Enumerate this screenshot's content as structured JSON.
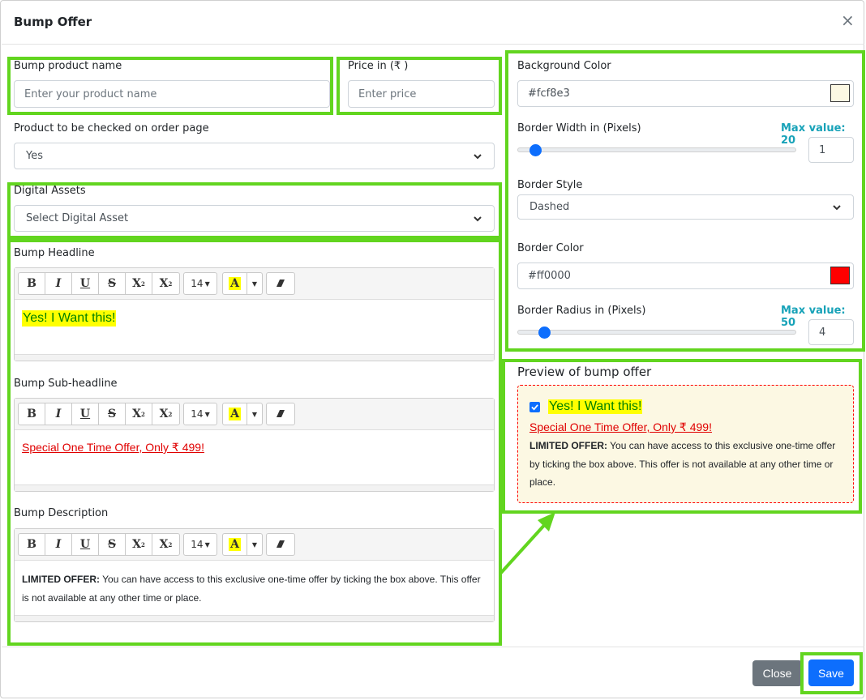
{
  "header": {
    "title": "Bump Offer",
    "close_glyph": "×"
  },
  "form": {
    "product_name": {
      "label": "Bump product name",
      "placeholder": "Enter your product name"
    },
    "price": {
      "label": "Price in (₹ )",
      "placeholder": "Enter price"
    },
    "checked": {
      "label": "Product to be checked on order page",
      "value": "Yes"
    },
    "assets": {
      "label": "Digital Assets",
      "value": "Select Digital Asset"
    }
  },
  "editors": {
    "headline": {
      "label": "Bump Headline",
      "content": "Yes! I Want this!"
    },
    "subheadline": {
      "label": "Bump Sub-headline",
      "content": "Special One Time Offer, Only ₹ 499!"
    },
    "description": {
      "label": "Bump Description",
      "content_bold": "LIMITED OFFER:",
      "content_rest": " You can have access to this exclusive one-time offer by ticking the box above. This offer is not available at any other time or place."
    },
    "toolbar": {
      "bold": "B",
      "italic": "I",
      "underline": "U",
      "strike": "S",
      "superscript": "X",
      "subscript": "X",
      "font_size": "14",
      "highlight": "A"
    }
  },
  "style": {
    "background_color": {
      "label": "Background Color",
      "value": "#fcf8e3"
    },
    "border_width": {
      "label": "Border Width in (Pixels)",
      "max": "Max value: 20",
      "value": "1",
      "level": 0.05
    },
    "border_style": {
      "label": "Border Style",
      "value": "Dashed"
    },
    "border_color": {
      "label": "Border Color",
      "value": "#ff0000"
    },
    "border_radius": {
      "label": "Border Radius in (Pixels)",
      "max": "Max value: 50",
      "value": "4",
      "level": 0.08
    }
  },
  "preview": {
    "title": "Preview of bump offer",
    "headline": "Yes! I Want this!",
    "subheadline": "Special One Time Offer, Only ₹ 499!",
    "desc_bold": "LIMITED OFFER:",
    "desc_rest": " You can have access to this exclusive one-time offer by ticking the box above. This offer is not available at any other time or place."
  },
  "footer": {
    "close_label": "Close",
    "save_label": "Save"
  },
  "colors": {
    "highlight_green": "#62d51f",
    "primary": "#0d6efd",
    "secondary": "#6c757d",
    "headline_bg": "#ffff00",
    "sub_red": "#e00000"
  }
}
